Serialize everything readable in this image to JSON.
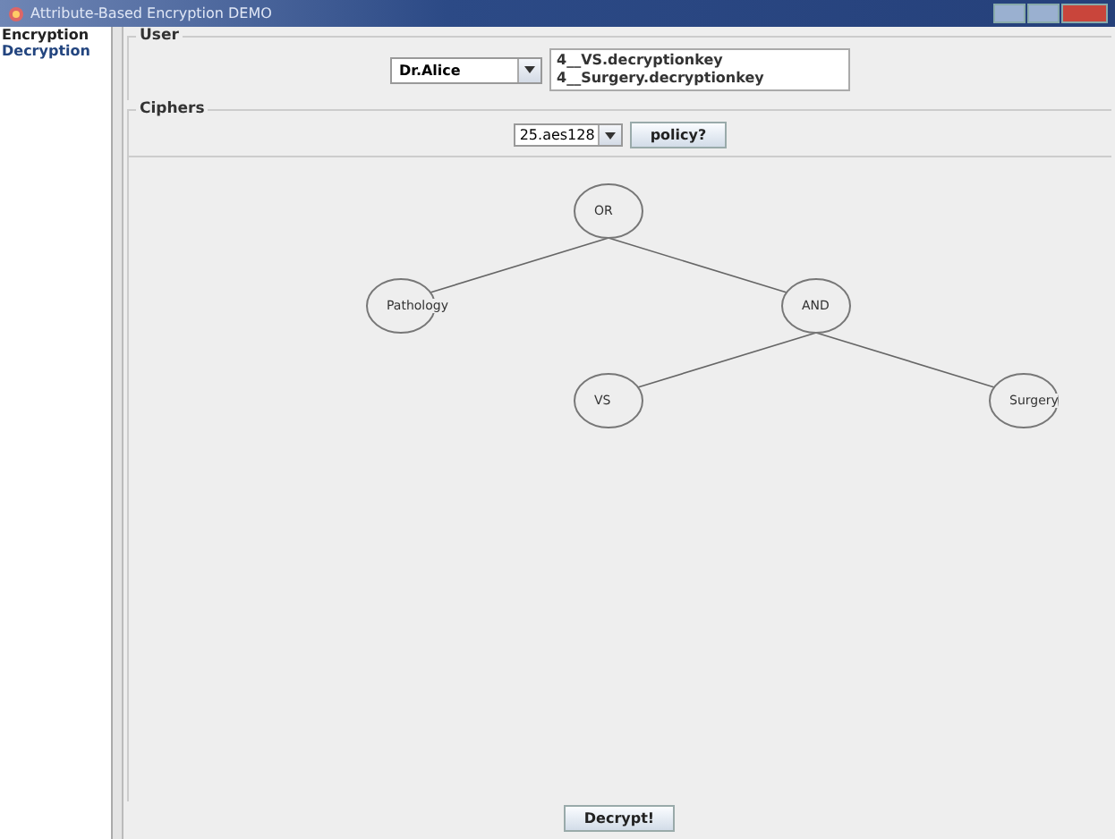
{
  "window": {
    "title": "Attribute-Based Encryption DEMO"
  },
  "sidebar": {
    "items": [
      {
        "label": "Encryption",
        "selected": false
      },
      {
        "label": "Decryption",
        "selected": true
      }
    ]
  },
  "user": {
    "title": "User",
    "selected_user": "Dr.Alice",
    "keys": [
      "4__VS.decryptionkey",
      "4__Surgery.decryptionkey"
    ]
  },
  "ciphers": {
    "title": "Ciphers",
    "selected_cipher": "25.aes128",
    "policy_button": "policy?"
  },
  "policy_tree": {
    "label": "OR",
    "children": [
      {
        "label": "Pathology"
      },
      {
        "label": "AND",
        "children": [
          {
            "label": "VS"
          },
          {
            "label": "Surgery"
          }
        ]
      }
    ]
  },
  "decrypt_button": "Decrypt!"
}
